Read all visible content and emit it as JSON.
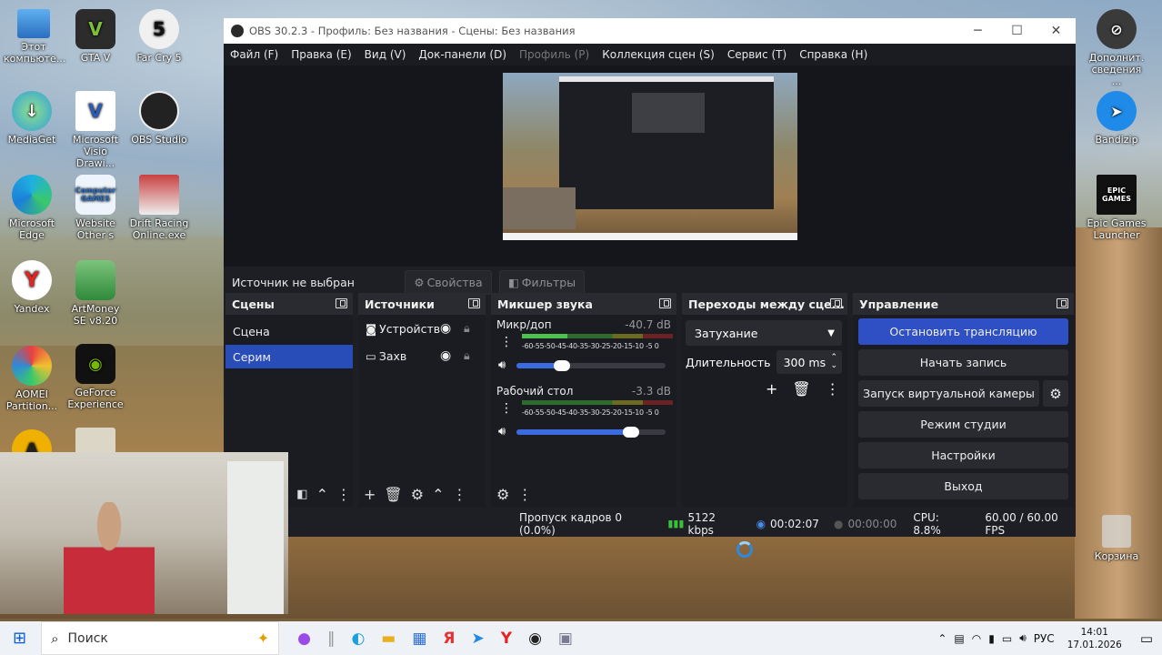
{
  "desktop": {
    "left_icons": [
      {
        "label": "Этот компьюте...",
        "icon": "computer-icon"
      },
      {
        "label": "GTA V",
        "icon": "gta-icon"
      },
      {
        "label": "Far Cry 5",
        "icon": "farcry-icon"
      },
      {
        "label": "MediaGet",
        "icon": "mediaget-icon"
      },
      {
        "label": "Microsoft Visio Drawi...",
        "icon": "visio-icon"
      },
      {
        "label": "OBS Studio",
        "icon": "obs-icon"
      },
      {
        "label": "Microsoft Edge",
        "icon": "edge-icon"
      },
      {
        "label": "Website Other s",
        "icon": "website-icon"
      },
      {
        "label": "Drift Racing Online.exe",
        "icon": "drift-icon"
      },
      {
        "label": "Yandex",
        "icon": "yandex-icon"
      },
      {
        "label": "ArtMoney SE v8.20",
        "icon": "artmoney-icon"
      },
      {
        "label": "AOMEI Partition...",
        "icon": "aomei-icon"
      },
      {
        "label": "GeForce Experience",
        "icon": "geforce-icon"
      }
    ],
    "right_icons": [
      {
        "label": "Дополнит. сведения ...",
        "icon": "info-icon"
      },
      {
        "label": "Bandizip",
        "icon": "bandizip-icon"
      },
      {
        "label": "Epic Games Launcher",
        "icon": "epic-icon",
        "logo_text": "EPIC GAMES"
      },
      {
        "label": "Корзина",
        "icon": "recycle-bin-icon"
      }
    ],
    "computer_games_text": "Computer GAMES"
  },
  "obs": {
    "title": "OBS 30.2.3 - Профиль: Без названия - Сцены: Без названия",
    "menu": [
      {
        "label": "Файл (F)",
        "enabled": true
      },
      {
        "label": "Правка (E)",
        "enabled": true
      },
      {
        "label": "Вид (V)",
        "enabled": true
      },
      {
        "label": "Док-панели (D)",
        "enabled": true
      },
      {
        "label": "Профиль (P)",
        "enabled": false
      },
      {
        "label": "Коллекция сцен (S)",
        "enabled": true
      },
      {
        "label": "Сервис (T)",
        "enabled": true
      },
      {
        "label": "Справка (H)",
        "enabled": true
      }
    ],
    "source_bar": {
      "no_source": "Источник не выбран",
      "properties": "Свойства",
      "filters": "Фильтры"
    },
    "scenes": {
      "title": "Сцены",
      "items": [
        {
          "label": "Сцена",
          "selected": false
        },
        {
          "label": "Серим",
          "selected": true
        }
      ]
    },
    "sources": {
      "title": "Источники",
      "items": [
        {
          "label": "Устройств",
          "icon": "camera-icon"
        },
        {
          "label": "Захв",
          "icon": "monitor-icon"
        }
      ]
    },
    "mixer": {
      "title": "Микшер звука",
      "ticks": "-60-55-50-45-40-35-30-25-20-15-10 -5  0",
      "channels": [
        {
          "name": "Микр/доп",
          "db": "-40.7 dB",
          "level": 0.3,
          "volume": 0.28
        },
        {
          "name": "Рабочий стол",
          "db": "-3.3 dB",
          "level": 0.0,
          "volume": 0.8
        }
      ]
    },
    "transitions": {
      "title": "Переходы между сце...",
      "selected": "Затухание",
      "duration_label": "Длительность",
      "duration_value": "300 ms"
    },
    "controls": {
      "title": "Управление",
      "buttons": [
        {
          "label": "Остановить трансляцию",
          "primary": true
        },
        {
          "label": "Начать запись",
          "primary": false
        },
        {
          "label": "Запуск виртуальной камеры",
          "primary": false
        },
        {
          "label": "Режим студии",
          "primary": false
        },
        {
          "label": "Настройки",
          "primary": false
        },
        {
          "label": "Выход",
          "primary": false
        }
      ]
    },
    "status": {
      "dropped": "Пропуск кадров 0 (0.0%)",
      "bitrate": "5122 kbps",
      "stream_time": "00:02:07",
      "rec_time": "00:00:00",
      "cpu": "CPU: 8.8%",
      "fps": "60.00 / 60.00 FPS"
    }
  },
  "taskbar": {
    "search_placeholder": "Поиск",
    "lang": "РУС",
    "time": "14:01",
    "date": "17.01.2026"
  },
  "colors": {
    "accent": "#2f4fc4",
    "selected_scene": "#284cb8",
    "panel": "#1b1c22"
  }
}
